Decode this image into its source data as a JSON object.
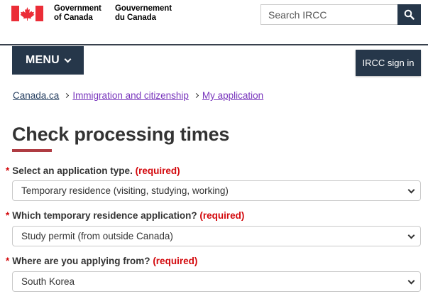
{
  "header": {
    "signature_en": [
      "Government",
      "of Canada"
    ],
    "signature_fr": [
      "Gouvernement",
      "du Canada"
    ],
    "search": {
      "placeholder": "Search IRCC",
      "icon": "search-icon"
    },
    "menu_label": "MENU",
    "signin_label": "IRCC sign in"
  },
  "breadcrumb": [
    "Canada.ca",
    "Immigration and citizenship",
    "My application"
  ],
  "page_title": "Check processing times",
  "form": {
    "required_text": "(required)",
    "fields": [
      {
        "label": "Select an application type.",
        "value": "Temporary residence (visiting, studying, working)"
      },
      {
        "label": "Which temporary residence application?",
        "value": "Study permit (from outside Canada)"
      },
      {
        "label": "Where are you applying from?",
        "value": "South Korea"
      }
    ]
  },
  "colors": {
    "flag_red": "#eb2d37",
    "nav_dark": "#26374a",
    "link": "#284162",
    "visited_link": "#7834bc",
    "required": "#d3080c",
    "title_accent": "#af3c43"
  }
}
